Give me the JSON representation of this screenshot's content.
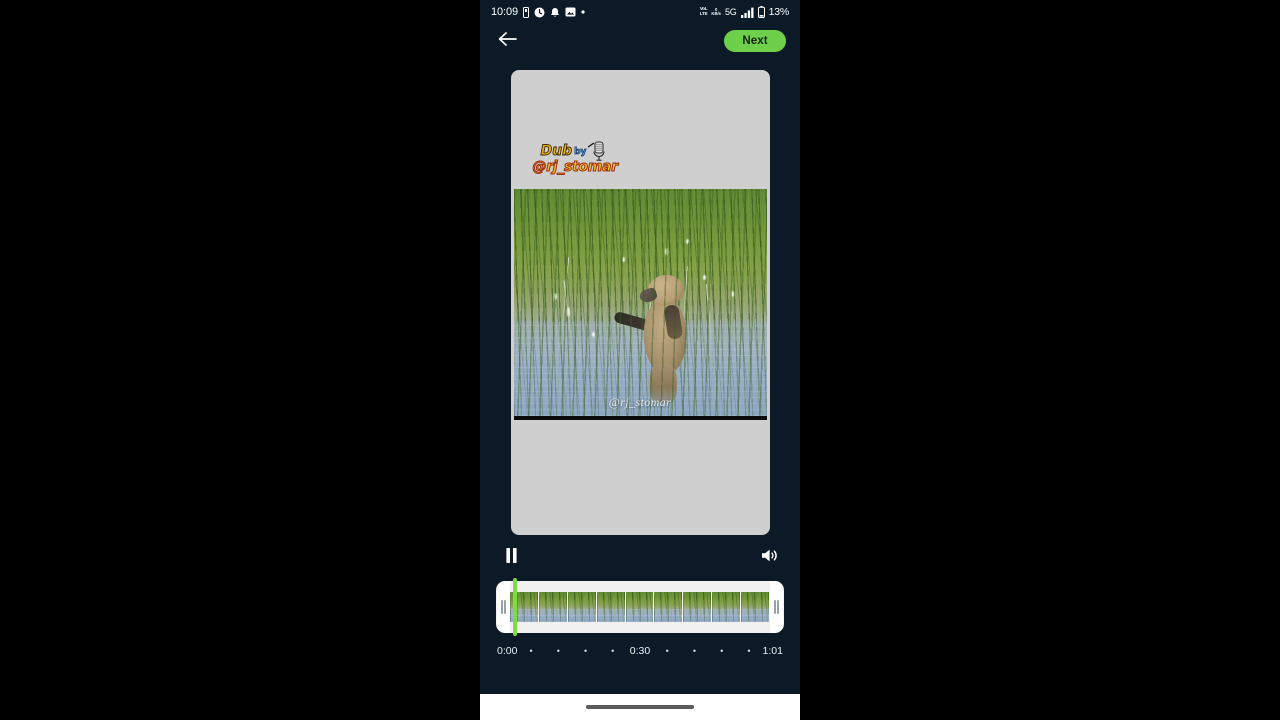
{
  "statusbar": {
    "time": "10:09",
    "left_icons": [
      "sim-card-icon",
      "clock-icon",
      "bell-icon",
      "gallery-icon",
      "dot-indicator-icon"
    ],
    "volte_label_top": "VoL",
    "volte_label_bottom": "LTE",
    "data_rate_top": "0",
    "data_rate_bottom": "KB/s",
    "network": "5G",
    "signal_icon": "signal-bars-icon",
    "battery_icon": "battery-icon",
    "battery_percent": "13%"
  },
  "topnav": {
    "back_icon": "arrow-left-icon",
    "next_label": "Next"
  },
  "preview": {
    "canvas_background": "#cfcfcf",
    "sticker": {
      "dub_text": "Dub",
      "by_text": "by",
      "handle_text": "@rj_stomar",
      "mic_icon": "microphone-icon",
      "dub_color": "#f5b301",
      "by_color": "#5aa0e6",
      "handle_color": "#f7c51a"
    },
    "clip_watermark": "@rj_stomar"
  },
  "controls": {
    "play_pause_icon": "pause-icon",
    "volume_icon": "volume-on-icon"
  },
  "timeline": {
    "left_trim_icon": "trim-handle-left-icon",
    "right_trim_icon": "trim-handle-right-icon",
    "playhead_color": "#7ddc3e",
    "playhead_position_percent": 6,
    "thumbnail_count": 9
  },
  "ruler": {
    "start": "0:00",
    "middle": "0:30",
    "end": "1:01",
    "dot": "•"
  },
  "gesture": {
    "pill": "home-gesture-pill"
  }
}
